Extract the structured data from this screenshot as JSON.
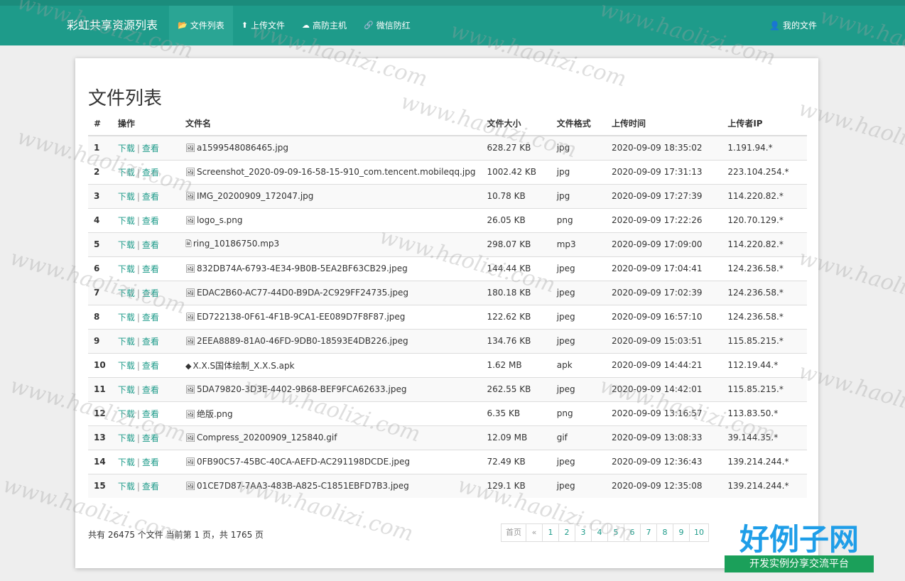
{
  "nav": {
    "brand": "彩虹共享资源列表",
    "items": [
      {
        "label": "文件列表",
        "icon": "folder-icon",
        "glyph": "📂",
        "active": true
      },
      {
        "label": "上传文件",
        "icon": "upload-icon",
        "glyph": "⬆",
        "active": false
      },
      {
        "label": "高防主机",
        "icon": "cloud-icon",
        "glyph": "☁",
        "active": false
      },
      {
        "label": "微信防红",
        "icon": "link-icon",
        "glyph": "🔗",
        "active": false
      }
    ],
    "user_label": "我的文件",
    "user_glyph": "👤"
  },
  "page": {
    "title": "文件列表"
  },
  "table": {
    "headers": [
      "#",
      "操作",
      "文件名",
      "文件大小",
      "文件格式",
      "上传时间",
      "上传者IP"
    ],
    "download_label": "下载",
    "view_label": "查看",
    "rows": [
      {
        "idx": "1",
        "name": "a1599548086465.jpg",
        "size": "628.27 KB",
        "type": "jpg",
        "time": "2020-09-09 18:35:02",
        "ip": "1.191.94.*",
        "icon": "🖼"
      },
      {
        "idx": "2",
        "name": "Screenshot_2020-09-09-16-58-15-910_com.tencent.mobileqq.jpg",
        "size": "1002.42 KB",
        "type": "jpg",
        "time": "2020-09-09 17:31:13",
        "ip": "223.104.254.*",
        "icon": "🖼"
      },
      {
        "idx": "3",
        "name": "IMG_20200909_172047.jpg",
        "size": "10.78 KB",
        "type": "jpg",
        "time": "2020-09-09 17:27:39",
        "ip": "114.220.82.*",
        "icon": "🖼"
      },
      {
        "idx": "4",
        "name": "logo_s.png",
        "size": "26.05 KB",
        "type": "png",
        "time": "2020-09-09 17:22:26",
        "ip": "120.70.129.*",
        "icon": "🖼"
      },
      {
        "idx": "5",
        "name": "ring_10186750.mp3",
        "size": "298.07 KB",
        "type": "mp3",
        "time": "2020-09-09 17:09:00",
        "ip": "114.220.82.*",
        "icon": "🖹"
      },
      {
        "idx": "6",
        "name": "832DB74A-6793-4E34-9B0B-5EA2BF63CB29.jpeg",
        "size": "144.44 KB",
        "type": "jpeg",
        "time": "2020-09-09 17:04:41",
        "ip": "124.236.58.*",
        "icon": "🖼"
      },
      {
        "idx": "7",
        "name": "EDAC2B60-AC77-44D0-B9DA-2C929FF24735.jpeg",
        "size": "180.18 KB",
        "type": "jpeg",
        "time": "2020-09-09 17:02:39",
        "ip": "124.236.58.*",
        "icon": "🖼"
      },
      {
        "idx": "8",
        "name": "ED722138-0F61-4F1B-9CA1-EE089D7F8F87.jpeg",
        "size": "122.62 KB",
        "type": "jpeg",
        "time": "2020-09-09 16:57:10",
        "ip": "124.236.58.*",
        "icon": "🖼"
      },
      {
        "idx": "9",
        "name": "2EEA8889-81A0-46FD-9DB0-18593E4DB226.jpeg",
        "size": "134.76 KB",
        "type": "jpeg",
        "time": "2020-09-09 15:03:51",
        "ip": "115.85.215.*",
        "icon": "🖼"
      },
      {
        "idx": "10",
        "name": "X.X.S国体绘制_X.X.S.apk",
        "size": "1.62 MB",
        "type": "apk",
        "time": "2020-09-09 14:44:21",
        "ip": "112.19.44.*",
        "icon": "◆"
      },
      {
        "idx": "11",
        "name": "5DA79820-3D3E-4402-9B68-BEF9FCA62633.jpeg",
        "size": "262.55 KB",
        "type": "jpeg",
        "time": "2020-09-09 14:42:01",
        "ip": "115.85.215.*",
        "icon": "🖼"
      },
      {
        "idx": "12",
        "name": "绝版.png",
        "size": "6.35 KB",
        "type": "png",
        "time": "2020-09-09 13:16:57",
        "ip": "113.83.50.*",
        "icon": "🖼"
      },
      {
        "idx": "13",
        "name": "Compress_20200909_125840.gif",
        "size": "12.09 MB",
        "type": "gif",
        "time": "2020-09-09 13:08:33",
        "ip": "39.144.35.*",
        "icon": "🖼"
      },
      {
        "idx": "14",
        "name": "0FB90C57-45BC-40CA-AEFD-AC291198DCDE.jpeg",
        "size": "72.49 KB",
        "type": "jpeg",
        "time": "2020-09-09 12:36:43",
        "ip": "139.214.244.*",
        "icon": "🖼"
      },
      {
        "idx": "15",
        "name": "01CE7D87-7AA3-483B-A825-C1851EBFD7B3.jpeg",
        "size": "129.1 KB",
        "type": "jpeg",
        "time": "2020-09-09 12:35:08",
        "ip": "139.214.244.*",
        "icon": "🖼"
      }
    ]
  },
  "footer": {
    "summary": "共有 26475 个文件  当前第 1 页，共 1765 页",
    "pager": [
      "首页",
      "«",
      "1",
      "2",
      "3",
      "4",
      "5",
      "6",
      "7",
      "8",
      "9",
      "10"
    ]
  },
  "watermark": {
    "text": "www.haolizi.com",
    "logo_big": "好例子网",
    "logo_small": "开发实例分享交流平台"
  }
}
